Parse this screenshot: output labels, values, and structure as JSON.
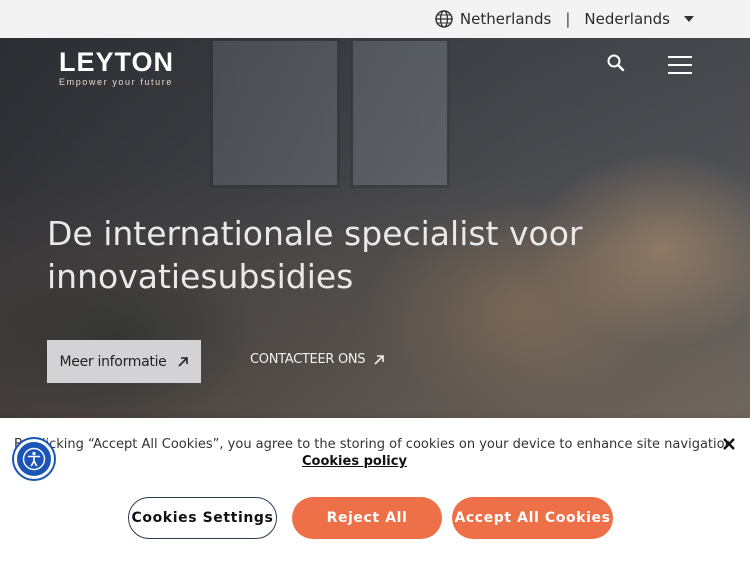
{
  "topbar": {
    "country": "Netherlands",
    "separator": "|",
    "language": "Nederlands",
    "icons": {
      "globe": "globe-icon",
      "caret": "caret-down-icon"
    }
  },
  "header": {
    "logo_text": "LEYTON",
    "logo_tagline": "Empower your future",
    "icons": {
      "search": "search-icon",
      "menu": "hamburger-menu-icon"
    }
  },
  "hero": {
    "headline_line1": "De internationale specialist voor",
    "headline_line2": "innovatiesubsidies",
    "primary_button": "Meer informatie",
    "secondary_link": "CONTACTEER ONS",
    "icons": {
      "arrow": "arrow-up-right-icon"
    }
  },
  "cookie_banner": {
    "text": "By clicking “Accept All Cookies”, you agree to the storing of cookies on your device to enhance site navigation, analyze site usage, and assist in our marketing efforts.",
    "policy_link": "Cookies policy",
    "settings_button": "Cookies Settings",
    "reject_button": "Reject All",
    "accept_button": "Accept All Cookies",
    "close_icon": "close-icon"
  },
  "accessibility": {
    "icon": "accessibility-icon"
  },
  "colors": {
    "accent": "#ee7048",
    "accessibility_blue": "#1c55b8",
    "topbar_bg": "#f3f3f4"
  }
}
